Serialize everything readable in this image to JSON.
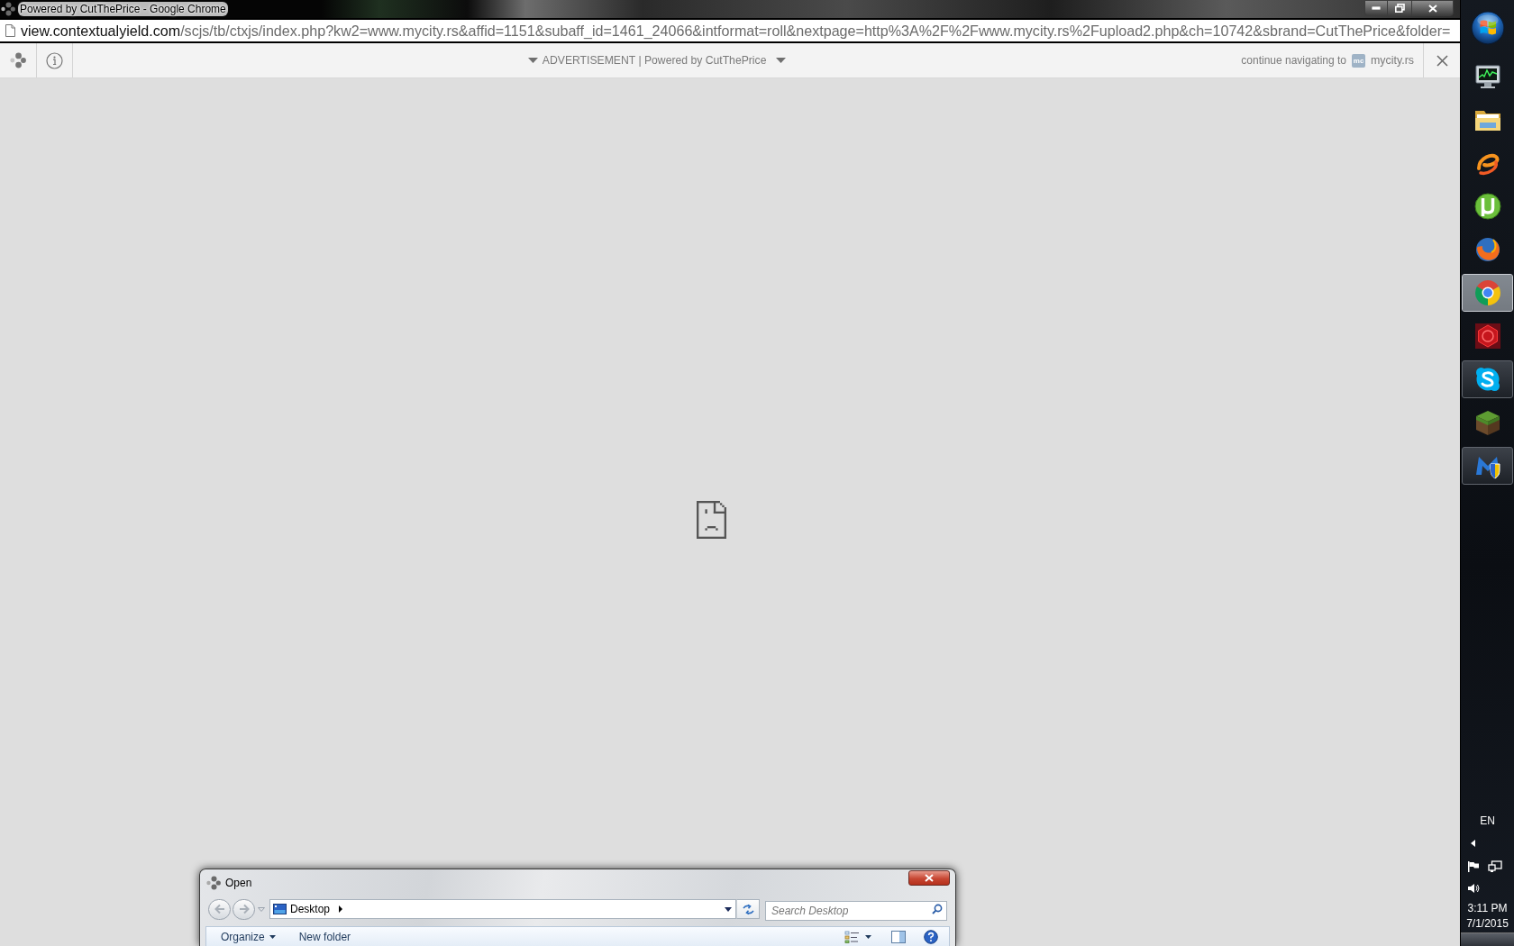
{
  "window": {
    "title": "Powered by CutThePrice - Google Chrome"
  },
  "address_bar": {
    "host": "view.contextualyield.com",
    "path": "/scjs/tb/ctxjs/index.php?kw2=www.mycity.rs&affid=1151&subaff_id=1461_24066&intformat=roll&nextpage=http%3A%2F%2Fwww.mycity.rs%2Fupload2.php&ch=10742&sbrand=CutThePrice&folder="
  },
  "ad_bar": {
    "label": "ADVERTISEMENT | Powered by CutThePrice",
    "continue_text": "continue navigating to",
    "site_logo": "mc",
    "site": "mycity.rs"
  },
  "open_dialog": {
    "title": "Open",
    "navigation": {
      "back": {
        "disabled": true
      },
      "forward": {
        "disabled": true
      }
    },
    "location": "Desktop",
    "search": {
      "placeholder": "Search Desktop"
    },
    "toolbar": [
      {
        "label": "Organize",
        "menu": true
      },
      {
        "label": "New folder",
        "menu": false
      }
    ]
  },
  "taskbar": {
    "buttons": [
      {
        "running": false,
        "active": false
      },
      {
        "running": false,
        "active": false
      },
      {
        "running": false,
        "active": false
      },
      {
        "running": false,
        "active": false
      },
      {
        "running": false,
        "active": false
      },
      {
        "running": true,
        "active": true
      },
      {
        "running": false,
        "active": false
      },
      {
        "running": true,
        "active": false
      },
      {
        "running": false,
        "active": false
      },
      {
        "running": true,
        "active": false
      }
    ],
    "tray": {
      "language": "EN",
      "time": "3:11 PM",
      "date": "7/1/2015"
    }
  }
}
